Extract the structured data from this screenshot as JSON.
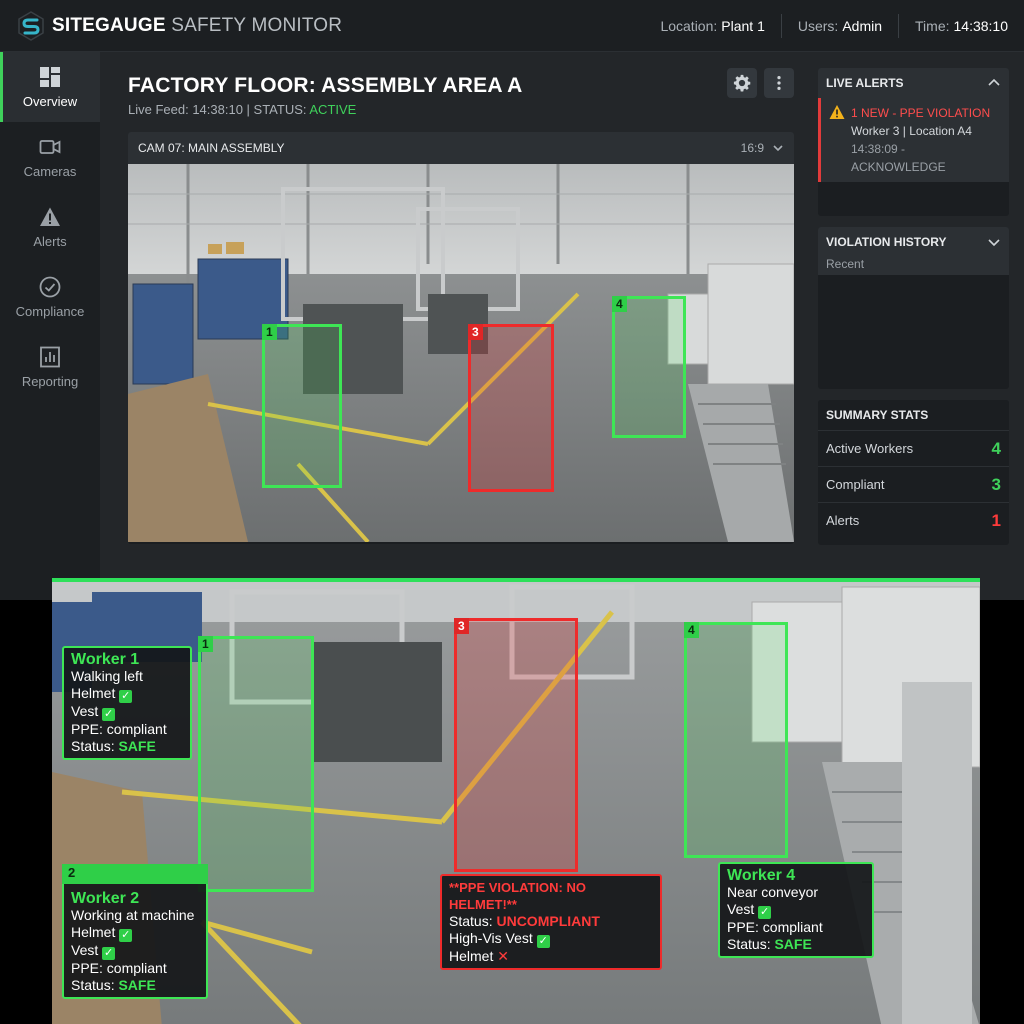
{
  "app": {
    "brand_bold": "SITEGAUGE",
    "brand_light": "SAFETY MONITOR",
    "location_label": "Location:",
    "location_value": "Plant 1",
    "users_label": "Users:",
    "users_value": "Admin",
    "time_label": "Time:",
    "time_value": "14:38:10"
  },
  "sidebar": {
    "items": [
      {
        "label": "Overview",
        "icon": "dashboard-icon",
        "active": true
      },
      {
        "label": "Cameras",
        "icon": "camera-icon"
      },
      {
        "label": "Alerts",
        "icon": "warning-icon"
      },
      {
        "label": "Compliance",
        "icon": "check-circle-icon"
      },
      {
        "label": "Reporting",
        "icon": "bar-chart-icon"
      }
    ]
  },
  "main": {
    "title": "FACTORY FLOOR: ASSEMBLY AREA A",
    "subtitle_prefix": "Live Feed: 14:38:10 | STATUS: ",
    "subtitle_status": "ACTIVE",
    "camera_title": "CAM 07: MAIN ASSEMBLY",
    "aspect_ratio": "16:9"
  },
  "detections": {
    "ids": [
      "1",
      "2",
      "3",
      "4"
    ]
  },
  "live_alerts": {
    "title": "LIVE ALERTS",
    "line1": "1 NEW - PPE VIOLATION",
    "line2": "Worker 3 | Location A4",
    "line3": "14:38:09 - ACKNOWLEDGE"
  },
  "violation_history": {
    "title": "VIOLATION HISTORY",
    "subtitle": "Recent"
  },
  "summary": {
    "title": "SUMMARY STATS",
    "rows": [
      {
        "label": "Active Workers",
        "value": "4",
        "color": "#3fd15b"
      },
      {
        "label": "Compliant",
        "value": "3",
        "color": "#3fd15b"
      },
      {
        "label": "Alerts",
        "value": "1",
        "color": "#ff3b3b"
      }
    ]
  },
  "zoom_labels": {
    "w1": {
      "name": "Worker 1",
      "activity": "Walking left",
      "helmet": "Helmet",
      "vest": "Vest",
      "ppe": "PPE: compliant",
      "status_label": "Status: ",
      "status_value": "SAFE"
    },
    "w2": {
      "name": "Worker 2",
      "activity": "Working at machine",
      "helmet": "Helmet",
      "vest": "Vest",
      "ppe": "PPE: compliant",
      "status_label": "Status: ",
      "status_value": "SAFE"
    },
    "w3": {
      "headline": "**PPE VIOLATION: NO HELMET!**",
      "status_label": "Status: ",
      "status_value": "UNCOMPLIANT",
      "vest": "High-Vis Vest",
      "helmet": "Helmet"
    },
    "w4": {
      "name": "Worker 4",
      "activity": "Near conveyor",
      "vest": "Vest",
      "ppe": "PPE: compliant",
      "status_label": "Status: ",
      "status_value": "SAFE"
    }
  }
}
